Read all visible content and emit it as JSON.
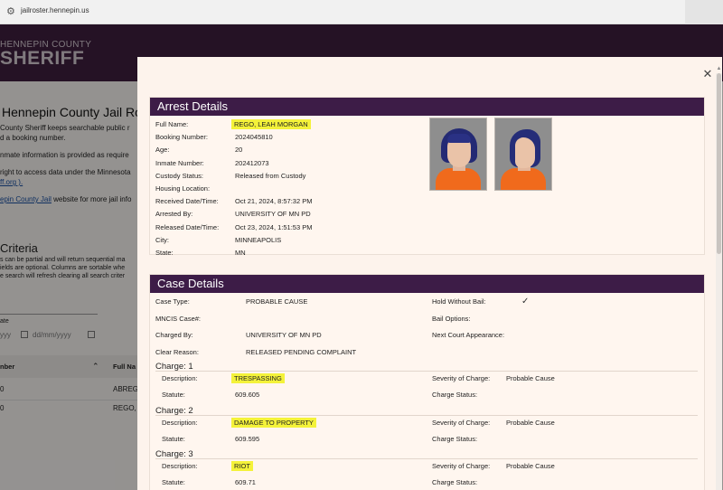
{
  "browser": {
    "url": "jailroster.hennepin.us"
  },
  "page": {
    "logo_top": "HENNEPIN COUNTY",
    "logo_bottom": "SHERIFF",
    "title": "Hennepin County Jail Ro",
    "intro1": "County Sheriff keeps searchable public r",
    "intro2": "d a booking number.",
    "intro3": "nmate information is provided as require",
    "intro4": "right to access data under the Minnesota",
    "intro5": "ff.org ).",
    "intro6_link": "epin County Jail",
    "intro6_rest": " website for more jail info",
    "criteria_title": "Criteria",
    "criteria1": "s can be partial and will return sequential ma",
    "criteria2": "ields are optional. Columns are sortable whe",
    "criteria3": "e search will refresh clearing all search criter",
    "date_label": "ate",
    "date_from_ph": "yyy",
    "date_to_ph": "dd/mm/yyyy",
    "col_number": "nber",
    "col_fullname": "Full Na",
    "row1_num": "0",
    "row1_name": "ABREG",
    "row2_num": "0",
    "row2_name": "REGO,"
  },
  "arrest": {
    "title": "Arrest Details",
    "fields": [
      {
        "label": "Full Name:",
        "value": "REGO, LEAH MORGAN"
      },
      {
        "label": "Booking Number:",
        "value": "2024045810"
      },
      {
        "label": "Age:",
        "value": "20"
      },
      {
        "label": "Inmate Number:",
        "value": "202412073"
      },
      {
        "label": "Custody Status:",
        "value": "Released from Custody"
      },
      {
        "label": "Housing Location:",
        "value": ""
      },
      {
        "label": "Received Date/Time:",
        "value": "Oct 21, 2024, 8:57:32 PM"
      },
      {
        "label": "Arrested By:",
        "value": "UNIVERSITY OF MN PD"
      },
      {
        "label": "Released Date/Time:",
        "value": "Oct 23, 2024, 1:51:53 PM"
      },
      {
        "label": "City:",
        "value": "MINNEAPOLIS"
      },
      {
        "label": "State:",
        "value": "MN"
      }
    ]
  },
  "case": {
    "title": "Case Details",
    "left": [
      {
        "label": "Case Type:",
        "value": "PROBABLE CAUSE"
      },
      {
        "label": "MNCIS Case#:",
        "value": ""
      },
      {
        "label": "Charged By:",
        "value": "UNIVERSITY OF MN PD"
      },
      {
        "label": "Clear Reason:",
        "value": "RELEASED PENDING COMPLAINT"
      }
    ],
    "right": [
      {
        "label": "Hold Without Bail:",
        "value": "✓"
      },
      {
        "label": "Bail Options:",
        "value": ""
      },
      {
        "label": "Next Court Appearance:",
        "value": ""
      }
    ],
    "charges": [
      {
        "heading": "Charge: 1",
        "description": "TRESPASSING",
        "statute": "609.605",
        "severity": "Probable Cause",
        "status": ""
      },
      {
        "heading": "Charge: 2",
        "description": "DAMAGE TO PROPERTY",
        "statute": "609.595",
        "severity": "Probable Cause",
        "status": ""
      },
      {
        "heading": "Charge: 3",
        "description": "RIOT",
        "statute": "609.71",
        "severity": "Probable Cause",
        "status": ""
      }
    ],
    "labels": {
      "description": "Description:",
      "statute": "Statute:",
      "severity": "Severity of Charge:",
      "status": "Charge Status:"
    }
  },
  "icons": {
    "close": "close-icon",
    "tune": "site-settings-icon",
    "check": "checkmark-icon"
  }
}
